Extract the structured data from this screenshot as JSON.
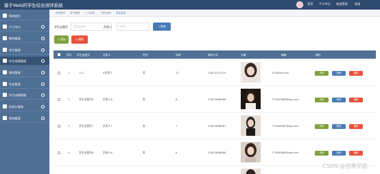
{
  "app": {
    "title": "基于Web的学生综合测评系统",
    "top_links": [
      "首页",
      "个人中心",
      "退出登录",
      "退出"
    ]
  },
  "colors": {
    "header": "#2e4a6e",
    "sidebar": "#4f6f95",
    "primary": "#4a7bb7",
    "success": "#7fa13b",
    "danger": "#e8503a"
  },
  "sidebar": {
    "items": [
      {
        "label": "系统首页",
        "icon": "home-icon"
      },
      {
        "label": "个人中心",
        "icon": "user-icon"
      },
      {
        "label": "教师管理",
        "icon": "teacher-icon"
      },
      {
        "label": "学生管理",
        "icon": "student-icon"
      },
      {
        "label": "学生成绩管理",
        "icon": "score-icon"
      },
      {
        "label": "课程管理",
        "icon": "course-icon"
      },
      {
        "label": "专业管理",
        "icon": "major-icon"
      },
      {
        "label": "学生成绩管理",
        "icon": "grade-icon"
      },
      {
        "label": "实践分管理",
        "icon": "practice-icon"
      },
      {
        "label": "系统管理",
        "icon": "settings-icon"
      }
    ]
  },
  "breadcrumb": [
    "系统首页",
    "用户管理",
    "个人信息",
    "修改密码",
    "学生信息"
  ],
  "filters": {
    "student_no_label": "学生自我号",
    "student_no_placeholder": "学生自我号",
    "owner_label": "负责人",
    "owner_placeholder": "负责人",
    "search_label": "查询"
  },
  "actions": {
    "add_label": "+ 添加",
    "delete_label": "✕ 删除"
  },
  "table": {
    "columns": [
      "序号",
      "学生自我号",
      "负责人",
      "性别",
      "年龄",
      "联系方式",
      "头像",
      "邮箱",
      "操作"
    ],
    "rows": [
      {
        "index": "1",
        "student_no": "111",
        "owner": "A负责人",
        "gender": "男",
        "age": "22",
        "phone": "13874747474",
        "email": "123@qq.com"
      },
      {
        "index": "2",
        "student_no": "学生自我号8",
        "owner": "负责人8",
        "gender": "男",
        "age": "8",
        "phone": "13823888888",
        "email": "773890888@qq.com"
      },
      {
        "index": "3",
        "student_no": "学生自我号7",
        "owner": "负责人7",
        "gender": "男",
        "age": "7",
        "phone": "13823888887",
        "email": "773890887@qq.com"
      },
      {
        "index": "4",
        "student_no": "学生自我号6",
        "owner": "负责人6",
        "gender": "男",
        "age": "6",
        "phone": "13823888886",
        "email": "773890886@qq.com"
      }
    ],
    "row_actions": {
      "detail": "详情",
      "edit": "修改",
      "delete": "删除"
    }
  },
  "watermark": "CSDN @信雅学姐"
}
